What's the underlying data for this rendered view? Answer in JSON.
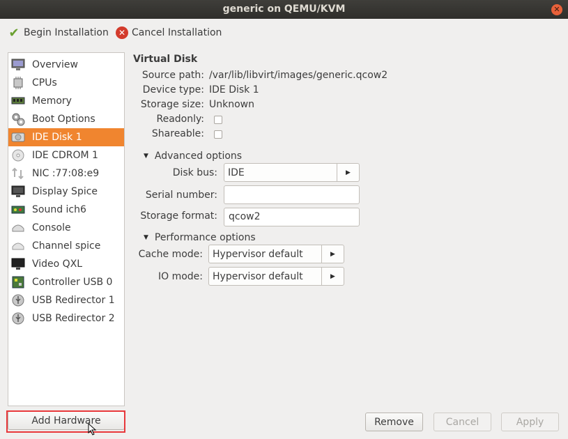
{
  "window": {
    "title": "generic on QEMU/KVM",
    "close_glyph": "✕"
  },
  "toolbar": {
    "begin_label": "Begin Installation",
    "cancel_label": "Cancel Installation",
    "begin_icon": "checkmark-icon",
    "cancel_icon": "cancel-icon"
  },
  "sidebar": {
    "items": [
      {
        "label": "Overview",
        "icon": "monitor-icon"
      },
      {
        "label": "CPUs",
        "icon": "cpu-icon"
      },
      {
        "label": "Memory",
        "icon": "memory-icon"
      },
      {
        "label": "Boot Options",
        "icon": "gears-icon"
      },
      {
        "label": "IDE Disk 1",
        "icon": "disk-icon",
        "selected": true
      },
      {
        "label": "IDE CDROM 1",
        "icon": "cdrom-icon"
      },
      {
        "label": "NIC :77:08:e9",
        "icon": "network-icon"
      },
      {
        "label": "Display Spice",
        "icon": "display-icon"
      },
      {
        "label": "Sound ich6",
        "icon": "sound-card-icon"
      },
      {
        "label": "Console",
        "icon": "console-icon"
      },
      {
        "label": "Channel spice",
        "icon": "channel-icon"
      },
      {
        "label": "Video QXL",
        "icon": "video-icon"
      },
      {
        "label": "Controller USB 0",
        "icon": "controller-icon"
      },
      {
        "label": "USB Redirector 1",
        "icon": "usb-icon"
      },
      {
        "label": "USB Redirector 2",
        "icon": "usb-icon"
      }
    ],
    "selected_color": "#f0852f",
    "add_hardware_label": "Add Hardware"
  },
  "details": {
    "heading": "Virtual Disk",
    "source_path_label": "Source path:",
    "source_path_value": "/var/lib/libvirt/images/generic.qcow2",
    "device_type_label": "Device type:",
    "device_type_value": "IDE Disk 1",
    "storage_size_label": "Storage size:",
    "storage_size_value": "Unknown",
    "readonly_label": "Readonly:",
    "shareable_label": "Shareable:",
    "advanced": {
      "label": "Advanced options",
      "disk_bus_label": "Disk bus:",
      "disk_bus_value": "IDE",
      "serial_label": "Serial number:",
      "serial_value": "",
      "format_label": "Storage format:",
      "format_value": "qcow2"
    },
    "performance": {
      "label": "Performance options",
      "cache_label": "Cache mode:",
      "cache_value": "Hypervisor default",
      "io_label": "IO mode:",
      "io_value": "Hypervisor default"
    }
  },
  "buttons": {
    "remove": "Remove",
    "cancel": "Cancel",
    "apply": "Apply"
  },
  "accent": {
    "highlight_color": "#e8383b"
  }
}
